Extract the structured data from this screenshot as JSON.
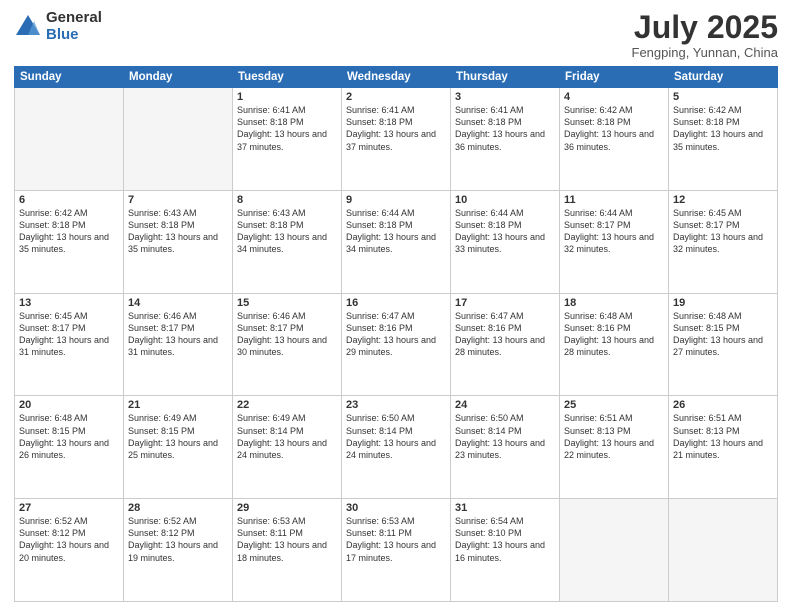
{
  "logo": {
    "general": "General",
    "blue": "Blue"
  },
  "title": {
    "month_year": "July 2025",
    "location": "Fengping, Yunnan, China"
  },
  "weekdays": [
    "Sunday",
    "Monday",
    "Tuesday",
    "Wednesday",
    "Thursday",
    "Friday",
    "Saturday"
  ],
  "weeks": [
    [
      {
        "num": "",
        "info": ""
      },
      {
        "num": "",
        "info": ""
      },
      {
        "num": "1",
        "info": "Sunrise: 6:41 AM\nSunset: 8:18 PM\nDaylight: 13 hours and 37 minutes."
      },
      {
        "num": "2",
        "info": "Sunrise: 6:41 AM\nSunset: 8:18 PM\nDaylight: 13 hours and 37 minutes."
      },
      {
        "num": "3",
        "info": "Sunrise: 6:41 AM\nSunset: 8:18 PM\nDaylight: 13 hours and 36 minutes."
      },
      {
        "num": "4",
        "info": "Sunrise: 6:42 AM\nSunset: 8:18 PM\nDaylight: 13 hours and 36 minutes."
      },
      {
        "num": "5",
        "info": "Sunrise: 6:42 AM\nSunset: 8:18 PM\nDaylight: 13 hours and 35 minutes."
      }
    ],
    [
      {
        "num": "6",
        "info": "Sunrise: 6:42 AM\nSunset: 8:18 PM\nDaylight: 13 hours and 35 minutes."
      },
      {
        "num": "7",
        "info": "Sunrise: 6:43 AM\nSunset: 8:18 PM\nDaylight: 13 hours and 35 minutes."
      },
      {
        "num": "8",
        "info": "Sunrise: 6:43 AM\nSunset: 8:18 PM\nDaylight: 13 hours and 34 minutes."
      },
      {
        "num": "9",
        "info": "Sunrise: 6:44 AM\nSunset: 8:18 PM\nDaylight: 13 hours and 34 minutes."
      },
      {
        "num": "10",
        "info": "Sunrise: 6:44 AM\nSunset: 8:18 PM\nDaylight: 13 hours and 33 minutes."
      },
      {
        "num": "11",
        "info": "Sunrise: 6:44 AM\nSunset: 8:17 PM\nDaylight: 13 hours and 32 minutes."
      },
      {
        "num": "12",
        "info": "Sunrise: 6:45 AM\nSunset: 8:17 PM\nDaylight: 13 hours and 32 minutes."
      }
    ],
    [
      {
        "num": "13",
        "info": "Sunrise: 6:45 AM\nSunset: 8:17 PM\nDaylight: 13 hours and 31 minutes."
      },
      {
        "num": "14",
        "info": "Sunrise: 6:46 AM\nSunset: 8:17 PM\nDaylight: 13 hours and 31 minutes."
      },
      {
        "num": "15",
        "info": "Sunrise: 6:46 AM\nSunset: 8:17 PM\nDaylight: 13 hours and 30 minutes."
      },
      {
        "num": "16",
        "info": "Sunrise: 6:47 AM\nSunset: 8:16 PM\nDaylight: 13 hours and 29 minutes."
      },
      {
        "num": "17",
        "info": "Sunrise: 6:47 AM\nSunset: 8:16 PM\nDaylight: 13 hours and 28 minutes."
      },
      {
        "num": "18",
        "info": "Sunrise: 6:48 AM\nSunset: 8:16 PM\nDaylight: 13 hours and 28 minutes."
      },
      {
        "num": "19",
        "info": "Sunrise: 6:48 AM\nSunset: 8:15 PM\nDaylight: 13 hours and 27 minutes."
      }
    ],
    [
      {
        "num": "20",
        "info": "Sunrise: 6:48 AM\nSunset: 8:15 PM\nDaylight: 13 hours and 26 minutes."
      },
      {
        "num": "21",
        "info": "Sunrise: 6:49 AM\nSunset: 8:15 PM\nDaylight: 13 hours and 25 minutes."
      },
      {
        "num": "22",
        "info": "Sunrise: 6:49 AM\nSunset: 8:14 PM\nDaylight: 13 hours and 24 minutes."
      },
      {
        "num": "23",
        "info": "Sunrise: 6:50 AM\nSunset: 8:14 PM\nDaylight: 13 hours and 24 minutes."
      },
      {
        "num": "24",
        "info": "Sunrise: 6:50 AM\nSunset: 8:14 PM\nDaylight: 13 hours and 23 minutes."
      },
      {
        "num": "25",
        "info": "Sunrise: 6:51 AM\nSunset: 8:13 PM\nDaylight: 13 hours and 22 minutes."
      },
      {
        "num": "26",
        "info": "Sunrise: 6:51 AM\nSunset: 8:13 PM\nDaylight: 13 hours and 21 minutes."
      }
    ],
    [
      {
        "num": "27",
        "info": "Sunrise: 6:52 AM\nSunset: 8:12 PM\nDaylight: 13 hours and 20 minutes."
      },
      {
        "num": "28",
        "info": "Sunrise: 6:52 AM\nSunset: 8:12 PM\nDaylight: 13 hours and 19 minutes."
      },
      {
        "num": "29",
        "info": "Sunrise: 6:53 AM\nSunset: 8:11 PM\nDaylight: 13 hours and 18 minutes."
      },
      {
        "num": "30",
        "info": "Sunrise: 6:53 AM\nSunset: 8:11 PM\nDaylight: 13 hours and 17 minutes."
      },
      {
        "num": "31",
        "info": "Sunrise: 6:54 AM\nSunset: 8:10 PM\nDaylight: 13 hours and 16 minutes."
      },
      {
        "num": "",
        "info": ""
      },
      {
        "num": "",
        "info": ""
      }
    ]
  ]
}
